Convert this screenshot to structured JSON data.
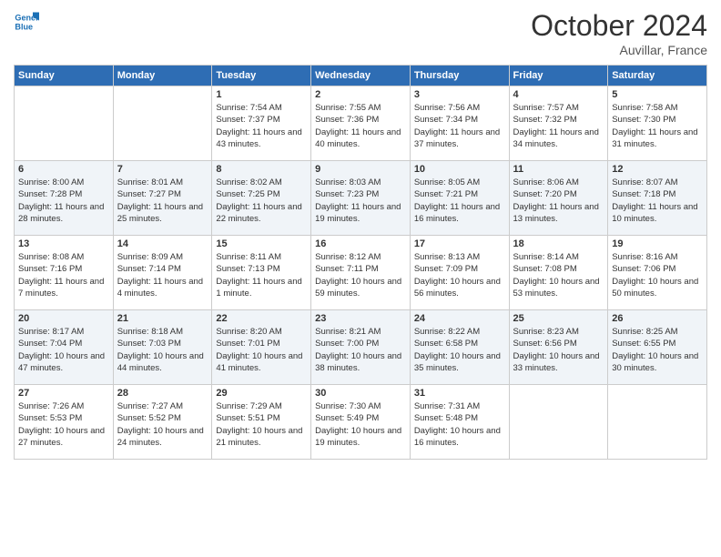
{
  "header": {
    "logo_line1": "General",
    "logo_line2": "Blue",
    "month_title": "October 2024",
    "location": "Auvillar, France"
  },
  "days_of_week": [
    "Sunday",
    "Monday",
    "Tuesday",
    "Wednesday",
    "Thursday",
    "Friday",
    "Saturday"
  ],
  "weeks": [
    [
      {
        "day": "",
        "sunrise": "",
        "sunset": "",
        "daylight": ""
      },
      {
        "day": "",
        "sunrise": "",
        "sunset": "",
        "daylight": ""
      },
      {
        "day": "1",
        "sunrise": "Sunrise: 7:54 AM",
        "sunset": "Sunset: 7:37 PM",
        "daylight": "Daylight: 11 hours and 43 minutes."
      },
      {
        "day": "2",
        "sunrise": "Sunrise: 7:55 AM",
        "sunset": "Sunset: 7:36 PM",
        "daylight": "Daylight: 11 hours and 40 minutes."
      },
      {
        "day": "3",
        "sunrise": "Sunrise: 7:56 AM",
        "sunset": "Sunset: 7:34 PM",
        "daylight": "Daylight: 11 hours and 37 minutes."
      },
      {
        "day": "4",
        "sunrise": "Sunrise: 7:57 AM",
        "sunset": "Sunset: 7:32 PM",
        "daylight": "Daylight: 11 hours and 34 minutes."
      },
      {
        "day": "5",
        "sunrise": "Sunrise: 7:58 AM",
        "sunset": "Sunset: 7:30 PM",
        "daylight": "Daylight: 11 hours and 31 minutes."
      }
    ],
    [
      {
        "day": "6",
        "sunrise": "Sunrise: 8:00 AM",
        "sunset": "Sunset: 7:28 PM",
        "daylight": "Daylight: 11 hours and 28 minutes."
      },
      {
        "day": "7",
        "sunrise": "Sunrise: 8:01 AM",
        "sunset": "Sunset: 7:27 PM",
        "daylight": "Daylight: 11 hours and 25 minutes."
      },
      {
        "day": "8",
        "sunrise": "Sunrise: 8:02 AM",
        "sunset": "Sunset: 7:25 PM",
        "daylight": "Daylight: 11 hours and 22 minutes."
      },
      {
        "day": "9",
        "sunrise": "Sunrise: 8:03 AM",
        "sunset": "Sunset: 7:23 PM",
        "daylight": "Daylight: 11 hours and 19 minutes."
      },
      {
        "day": "10",
        "sunrise": "Sunrise: 8:05 AM",
        "sunset": "Sunset: 7:21 PM",
        "daylight": "Daylight: 11 hours and 16 minutes."
      },
      {
        "day": "11",
        "sunrise": "Sunrise: 8:06 AM",
        "sunset": "Sunset: 7:20 PM",
        "daylight": "Daylight: 11 hours and 13 minutes."
      },
      {
        "day": "12",
        "sunrise": "Sunrise: 8:07 AM",
        "sunset": "Sunset: 7:18 PM",
        "daylight": "Daylight: 11 hours and 10 minutes."
      }
    ],
    [
      {
        "day": "13",
        "sunrise": "Sunrise: 8:08 AM",
        "sunset": "Sunset: 7:16 PM",
        "daylight": "Daylight: 11 hours and 7 minutes."
      },
      {
        "day": "14",
        "sunrise": "Sunrise: 8:09 AM",
        "sunset": "Sunset: 7:14 PM",
        "daylight": "Daylight: 11 hours and 4 minutes."
      },
      {
        "day": "15",
        "sunrise": "Sunrise: 8:11 AM",
        "sunset": "Sunset: 7:13 PM",
        "daylight": "Daylight: 11 hours and 1 minute."
      },
      {
        "day": "16",
        "sunrise": "Sunrise: 8:12 AM",
        "sunset": "Sunset: 7:11 PM",
        "daylight": "Daylight: 10 hours and 59 minutes."
      },
      {
        "day": "17",
        "sunrise": "Sunrise: 8:13 AM",
        "sunset": "Sunset: 7:09 PM",
        "daylight": "Daylight: 10 hours and 56 minutes."
      },
      {
        "day": "18",
        "sunrise": "Sunrise: 8:14 AM",
        "sunset": "Sunset: 7:08 PM",
        "daylight": "Daylight: 10 hours and 53 minutes."
      },
      {
        "day": "19",
        "sunrise": "Sunrise: 8:16 AM",
        "sunset": "Sunset: 7:06 PM",
        "daylight": "Daylight: 10 hours and 50 minutes."
      }
    ],
    [
      {
        "day": "20",
        "sunrise": "Sunrise: 8:17 AM",
        "sunset": "Sunset: 7:04 PM",
        "daylight": "Daylight: 10 hours and 47 minutes."
      },
      {
        "day": "21",
        "sunrise": "Sunrise: 8:18 AM",
        "sunset": "Sunset: 7:03 PM",
        "daylight": "Daylight: 10 hours and 44 minutes."
      },
      {
        "day": "22",
        "sunrise": "Sunrise: 8:20 AM",
        "sunset": "Sunset: 7:01 PM",
        "daylight": "Daylight: 10 hours and 41 minutes."
      },
      {
        "day": "23",
        "sunrise": "Sunrise: 8:21 AM",
        "sunset": "Sunset: 7:00 PM",
        "daylight": "Daylight: 10 hours and 38 minutes."
      },
      {
        "day": "24",
        "sunrise": "Sunrise: 8:22 AM",
        "sunset": "Sunset: 6:58 PM",
        "daylight": "Daylight: 10 hours and 35 minutes."
      },
      {
        "day": "25",
        "sunrise": "Sunrise: 8:23 AM",
        "sunset": "Sunset: 6:56 PM",
        "daylight": "Daylight: 10 hours and 33 minutes."
      },
      {
        "day": "26",
        "sunrise": "Sunrise: 8:25 AM",
        "sunset": "Sunset: 6:55 PM",
        "daylight": "Daylight: 10 hours and 30 minutes."
      }
    ],
    [
      {
        "day": "27",
        "sunrise": "Sunrise: 7:26 AM",
        "sunset": "Sunset: 5:53 PM",
        "daylight": "Daylight: 10 hours and 27 minutes."
      },
      {
        "day": "28",
        "sunrise": "Sunrise: 7:27 AM",
        "sunset": "Sunset: 5:52 PM",
        "daylight": "Daylight: 10 hours and 24 minutes."
      },
      {
        "day": "29",
        "sunrise": "Sunrise: 7:29 AM",
        "sunset": "Sunset: 5:51 PM",
        "daylight": "Daylight: 10 hours and 21 minutes."
      },
      {
        "day": "30",
        "sunrise": "Sunrise: 7:30 AM",
        "sunset": "Sunset: 5:49 PM",
        "daylight": "Daylight: 10 hours and 19 minutes."
      },
      {
        "day": "31",
        "sunrise": "Sunrise: 7:31 AM",
        "sunset": "Sunset: 5:48 PM",
        "daylight": "Daylight: 10 hours and 16 minutes."
      },
      {
        "day": "",
        "sunrise": "",
        "sunset": "",
        "daylight": ""
      },
      {
        "day": "",
        "sunrise": "",
        "sunset": "",
        "daylight": ""
      }
    ]
  ]
}
